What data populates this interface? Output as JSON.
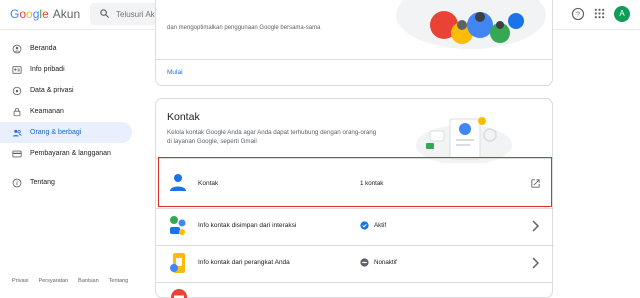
{
  "app": {
    "logo_google": "Google",
    "logo_akun": "Akun",
    "avatar_letter": "A"
  },
  "search": {
    "placeholder": "Telusuri Akun Google"
  },
  "sidebar": {
    "items": [
      {
        "label": "Beranda",
        "icon": "home-icon"
      },
      {
        "label": "Info pribadi",
        "icon": "id-card-icon"
      },
      {
        "label": "Data & privasi",
        "icon": "data-privacy-icon"
      },
      {
        "label": "Keamanan",
        "icon": "lock-icon"
      },
      {
        "label": "Orang & berbagi",
        "icon": "people-icon",
        "active": true
      },
      {
        "label": "Pembayaran & langganan",
        "icon": "credit-card-icon"
      }
    ],
    "about": {
      "label": "Tentang",
      "icon": "info-icon"
    }
  },
  "footer": {
    "links": [
      "Privasi",
      "Persyaratan",
      "Bantuan",
      "Tentang"
    ]
  },
  "card_top": {
    "description": "dan mengoptimalkan penggunaan Google bersama-sama",
    "action": "Mulai"
  },
  "contacts_card": {
    "title": "Kontak",
    "description": "Kelola kontak Google Anda agar Anda dapat terhubung dengan orang-orang di layanan Google, seperti Gmail",
    "rows": [
      {
        "label": "Kontak",
        "value": "1 kontak",
        "icon": "person-icon",
        "action_icon": "open-external-icon"
      },
      {
        "label": "Info kontak disimpan dari interaksi",
        "status": "Aktif",
        "status_icon": "check-circle-icon",
        "action_icon": "chevron-right-icon"
      },
      {
        "label": "Info kontak dari perangkat Anda",
        "status": "Nonaktif",
        "status_icon": "minus-circle-icon",
        "action_icon": "chevron-right-icon"
      }
    ]
  },
  "colors": {
    "accent": "#1a73e8",
    "active_bg": "#e8f0fe",
    "highlight_border": "#d93025"
  }
}
